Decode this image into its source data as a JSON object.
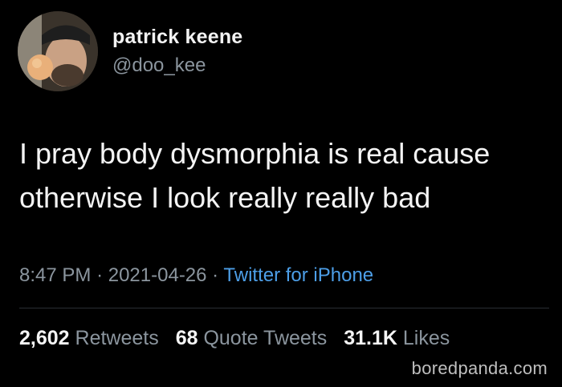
{
  "tweet": {
    "author": {
      "display_name": "patrick keene",
      "handle": "@doo_kee"
    },
    "text_lines": [
      "I pray body dysmorphia is real cause",
      "otherwise I look really really bad"
    ],
    "meta": {
      "time": "8:47 PM",
      "separator": "·",
      "date": "2021-04-26",
      "source": "Twitter for iPhone"
    },
    "stats": {
      "retweets_count": "2,602",
      "retweets_label": "Retweets",
      "quotes_count": "68",
      "quotes_label": "Quote Tweets",
      "likes_count": "31.1K",
      "likes_label": "Likes"
    }
  },
  "watermark": "boredpanda.com",
  "colors": {
    "background": "#000000",
    "text_primary": "#f4f4f4",
    "text_secondary": "#8b959e",
    "link": "#4d9fe8"
  }
}
